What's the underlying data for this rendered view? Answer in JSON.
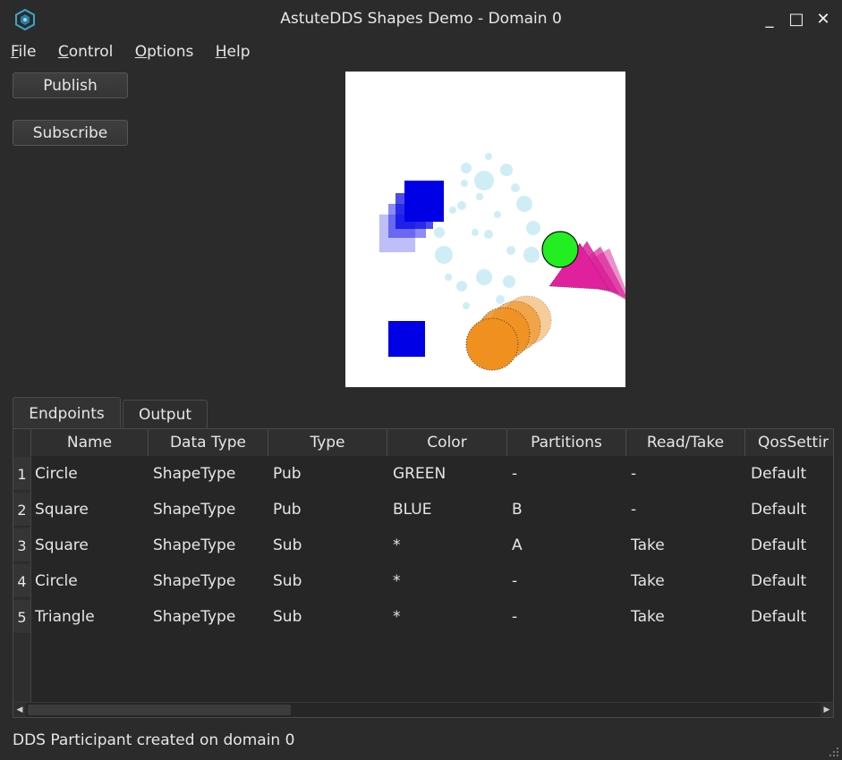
{
  "window": {
    "title": "AstuteDDS Shapes Demo - Domain 0",
    "minimize_glyph": "_",
    "maximize_glyph": "□",
    "close_glyph": "✕"
  },
  "menu": [
    {
      "accel": "F",
      "rest": "ile"
    },
    {
      "accel": "C",
      "rest": "ontrol"
    },
    {
      "accel": "O",
      "rest": "ptions"
    },
    {
      "accel": "H",
      "rest": "elp"
    }
  ],
  "buttons": {
    "publish": "Publish",
    "subscribe": "Subscribe"
  },
  "tabs": {
    "endpoints": "Endpoints",
    "output": "Output"
  },
  "table": {
    "headers": [
      "Name",
      "Data Type",
      "Type",
      "Color",
      "Partitions",
      "Read/Take",
      "QosSettir"
    ],
    "rows": [
      {
        "num": "1",
        "cells": [
          "Circle",
          "ShapeType",
          "Pub",
          "GREEN",
          "-",
          "-",
          "Default"
        ]
      },
      {
        "num": "2",
        "cells": [
          "Square",
          "ShapeType",
          "Pub",
          "BLUE",
          "B",
          "-",
          "Default"
        ]
      },
      {
        "num": "3",
        "cells": [
          "Square",
          "ShapeType",
          "Sub",
          "*",
          "A",
          "Take",
          "Default"
        ]
      },
      {
        "num": "4",
        "cells": [
          "Circle",
          "ShapeType",
          "Sub",
          "*",
          "-",
          "Take",
          "Default"
        ]
      },
      {
        "num": "5",
        "cells": [
          "Triangle",
          "ShapeType",
          "Sub",
          "*",
          "-",
          "Take",
          "Default"
        ]
      }
    ],
    "scroll_left_glyph": "◀",
    "scroll_right_glyph": "▶"
  },
  "status": "DDS Participant created on domain 0",
  "colors": {
    "shape_blue": "#0000e6",
    "shape_green": "#22ee22",
    "shape_orange": "#f0901e",
    "shape_magenta": "#e0209c",
    "ghost_cyan": "#a8e0ee"
  }
}
